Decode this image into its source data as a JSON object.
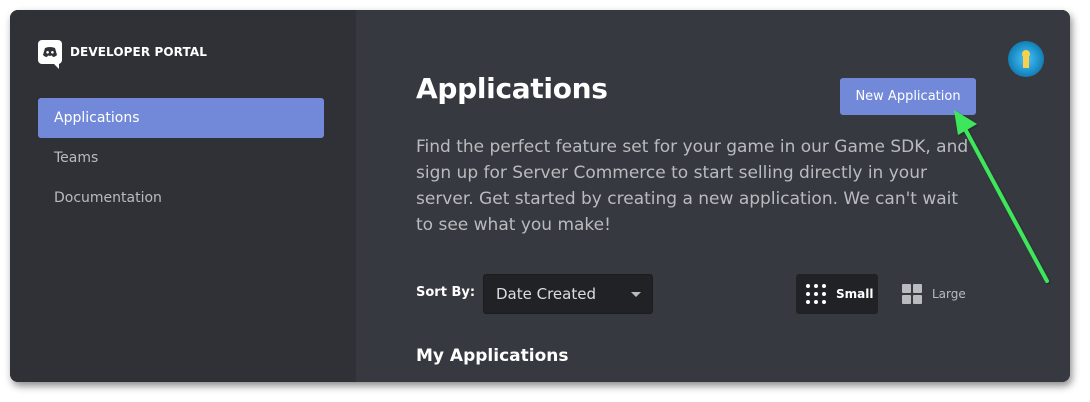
{
  "sidebar": {
    "brand_label": "DEVELOPER PORTAL",
    "brand_icon": "discord-logo-icon",
    "items": [
      {
        "label": "Applications",
        "active": true
      },
      {
        "label": "Teams",
        "active": false
      },
      {
        "label": "Documentation",
        "active": false
      }
    ]
  },
  "main": {
    "title": "Applications",
    "new_app_label": "New Application",
    "description": "Find the perfect feature set for your game in our Game SDK, and sign up for Server Commerce to start selling directly in your server. Get started by creating a new application. We can't wait to see what you make!",
    "sort_label": "Sort By:",
    "sort_value": "Date Created",
    "view_small_label": "Small",
    "view_large_label": "Large",
    "view_selected": "Small",
    "section_title": "My Applications"
  },
  "colors": {
    "accent": "#7289da",
    "sidebar_bg": "#2f3136",
    "main_bg": "#36393f",
    "annotation_arrow": "#3ee65a"
  }
}
